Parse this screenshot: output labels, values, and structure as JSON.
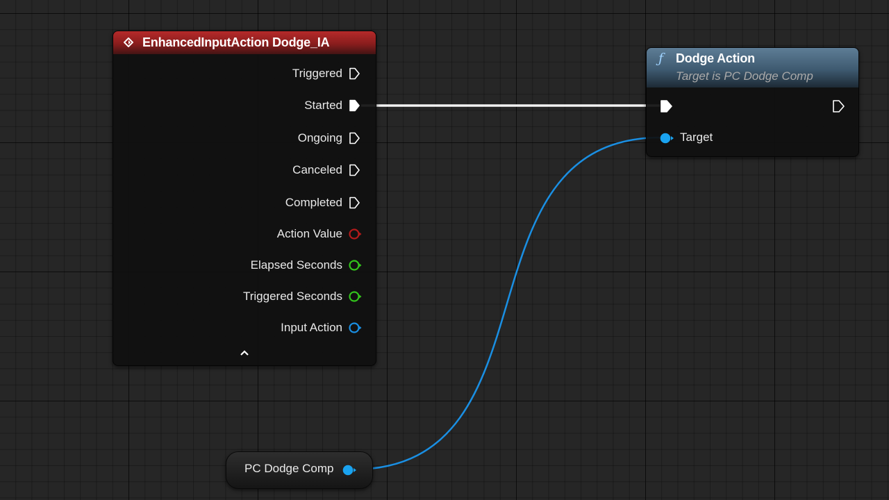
{
  "event_node": {
    "title": "EnhancedInputAction Dodge_IA",
    "header_color": "#a82626",
    "icon": "event-diamond-icon",
    "outputs": [
      {
        "label": "Triggered",
        "type": "exec",
        "connected": false
      },
      {
        "label": "Started",
        "type": "exec",
        "connected": true
      },
      {
        "label": "Ongoing",
        "type": "exec",
        "connected": false
      },
      {
        "label": "Canceled",
        "type": "exec",
        "connected": false
      },
      {
        "label": "Completed",
        "type": "exec",
        "connected": false
      },
      {
        "label": "Action Value",
        "type": "data",
        "color": "#b31b1b",
        "connected": false
      },
      {
        "label": "Elapsed Seconds",
        "type": "data",
        "color": "#33c41c",
        "connected": false
      },
      {
        "label": "Triggered Seconds",
        "type": "data",
        "color": "#33c41c",
        "connected": false
      },
      {
        "label": "Input Action",
        "type": "data",
        "color": "#1a8fe3",
        "connected": false
      }
    ],
    "collapse_icon": "chevron-up-icon"
  },
  "function_node": {
    "title": "Dodge Action",
    "subtitle": "Target is PC Dodge Comp",
    "header_color": "#4d6a80",
    "icon": "function-f-icon",
    "target_label": "Target",
    "target_color": "#1aa3f0"
  },
  "variable_node": {
    "label": "PC Dodge Comp",
    "pin_color": "#1aa3f0"
  },
  "wires": {
    "exec_color": "#f2f2f2",
    "object_color": "#1a8fe3"
  }
}
